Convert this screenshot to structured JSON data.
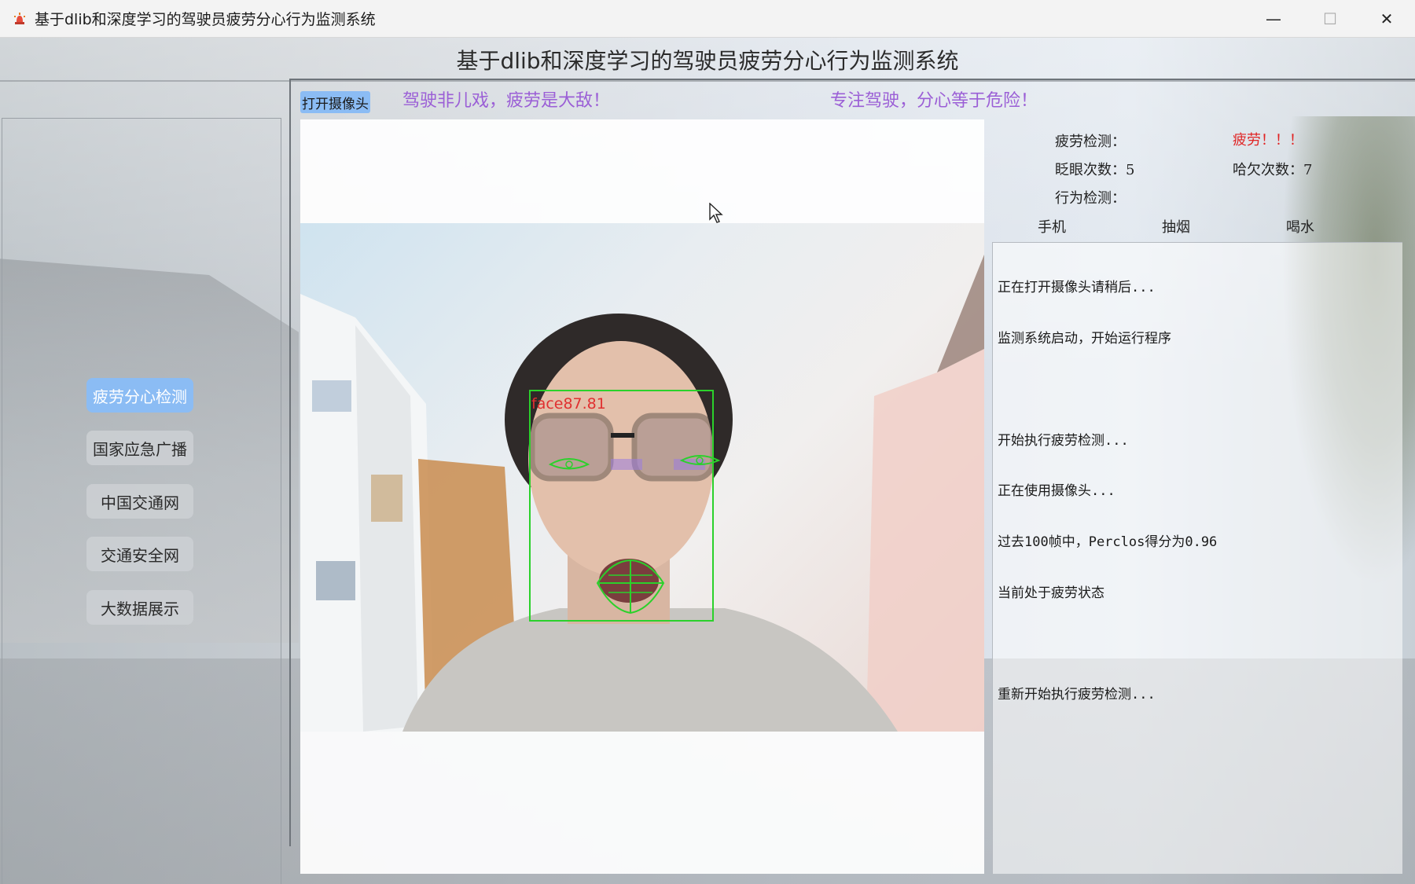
{
  "window": {
    "title": "基于dlib和深度学习的驾驶员疲劳分心行为监测系统",
    "controls": {
      "minimize": "—",
      "maximize": "☐",
      "close": "✕"
    }
  },
  "header": {
    "title": "基于dlib和深度学习的驾驶员疲劳分心行为监测系统",
    "slogans": [
      "驾驶非儿戏，疲劳是大敌！",
      "专注驾驶，分心等于危险！"
    ]
  },
  "nav": {
    "items": [
      {
        "label": "疲劳分心检测",
        "active": true
      },
      {
        "label": "国家应急广播",
        "active": false
      },
      {
        "label": "中国交通网",
        "active": false
      },
      {
        "label": "交通安全网",
        "active": false
      },
      {
        "label": "大数据展示",
        "active": false
      }
    ]
  },
  "camera": {
    "open_button": "打开摄像头",
    "face_label": "face87.81"
  },
  "stats": {
    "fatigue_label": "疲劳检测：",
    "fatigue_value": "疲劳！！！",
    "blink_label": "眨眼次数：5",
    "yawn_label": "哈欠次数：7",
    "behavior_label": "行为检测："
  },
  "behaviors": [
    "手机",
    "抽烟",
    "喝水"
  ],
  "log": [
    "正在打开摄像头请稍后...",
    "监测系统启动，开始运行程序",
    "",
    "开始执行疲劳检测...",
    "正在使用摄像头...",
    "过去100帧中，Perclos得分为0.96",
    "当前处于疲劳状态",
    "",
    "重新开始执行疲劳检测..."
  ],
  "colors": {
    "accent": "#8bbcf4",
    "slogan": "#9b5fd6",
    "alert": "#e02424",
    "detection": "#2bd12b",
    "face_label": "#e03030"
  }
}
